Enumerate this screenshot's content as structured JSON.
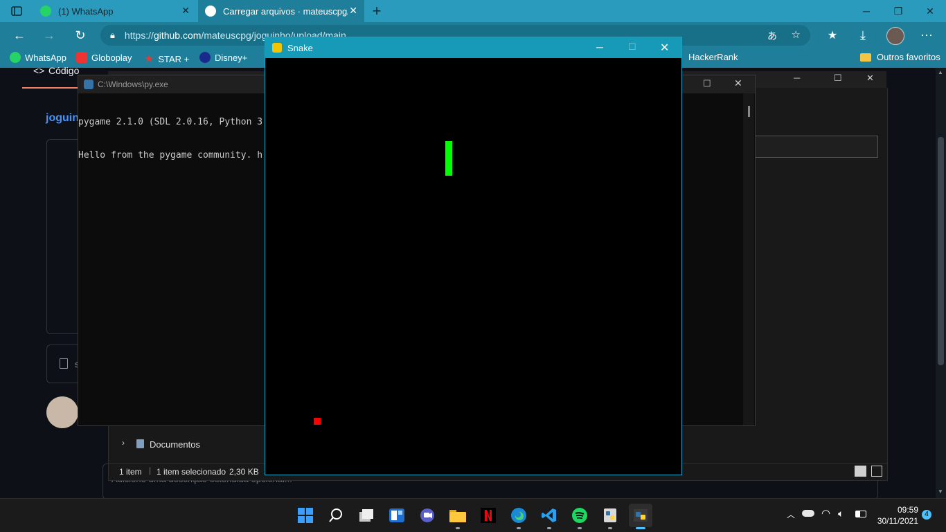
{
  "browser": {
    "tabs": [
      {
        "title": "(1) WhatsApp"
      },
      {
        "title": "Carregar arquivos · mateuscpg/jo"
      }
    ],
    "url": {
      "prefix": "https://",
      "domain": "github.com",
      "path": "/mateuscpg/joguinho/upload/main"
    },
    "bookmarks": [
      "WhatsApp",
      "Globoplay",
      "STAR +",
      "Disney+",
      "HackerRank"
    ],
    "other_favorites": "Outros favoritos"
  },
  "github": {
    "nav_label": "Código",
    "repo_name": "joguin",
    "file_letter": "s",
    "description_placeholder": "Adicione uma descrição estendida opcional..."
  },
  "console": {
    "title": "C:\\Windows\\py.exe",
    "lines": [
      "pygame 2.1.0 (SDL 2.0.16, Python 3",
      "Hello from the pygame community. h"
    ]
  },
  "explorer": {
    "tree_item": "Documentos",
    "status_items": "1 item",
    "status_selected": "1 item selecionado",
    "status_size": "2,30 KB"
  },
  "snake_window": {
    "title": "Snake",
    "snake_color": "#00ff00",
    "food_color": "#ff0000"
  },
  "taskbar": {
    "time": "09:59",
    "date": "30/11/2021",
    "notifications": "4"
  },
  "colors": {
    "tab_bar": "#2a9bbd",
    "browser_chrome": "#1f7f9b",
    "snake_titlebar": "#1799b8",
    "github_bg": "#0d1117"
  }
}
